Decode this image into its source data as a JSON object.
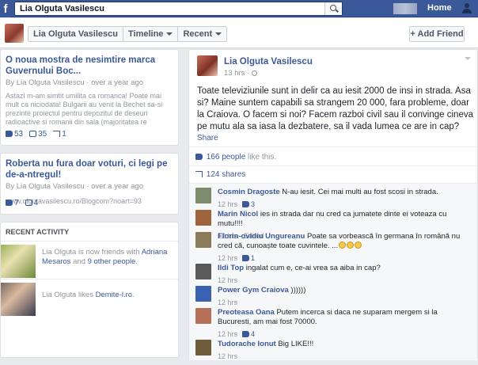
{
  "topbar": {
    "logo": "f",
    "search_value": "Lia Olguta Vasilescu",
    "home": "Home"
  },
  "subbar": {
    "name": "Lia Olguta Vasilescu",
    "timeline": "Timeline",
    "recent": "Recent",
    "add_friend": "Add Friend"
  },
  "left_posts": [
    {
      "title": "O noua mostra de nesimtire marca Guvernului Boc...",
      "meta": "By Lia Olguta Vasilescu · over a year ago",
      "body": "Astazi m-am simtit umilita ca romanca! Poate mai mult ca niciodata! Bulgarii au venit la Bechet sa-si prezinte proiectul pentru depozitul de deseuri radioactive si romanii din sala (majoritatea re",
      "likes": "53",
      "comments": "35",
      "shares": "1"
    },
    {
      "title": "Roberta nu fura doar voturi, ci legi pe de-a-ntregul!",
      "meta": "By Lia Olguta Vasilescu · over a year ago",
      "link": "www.olgutavasilescu.ro/Blogcom?noart=93",
      "likes": "7",
      "comments": "4"
    }
  ],
  "recent_activity": {
    "heading": "RECENT ACTIVITY",
    "items": [
      {
        "pre": "Lia Olguta is now friends with ",
        "link1": "Adriana Mesaros",
        "mid": " and ",
        "link2": "9 other people",
        "post": "."
      },
      {
        "pre": "Lia Olguta likes ",
        "link1": "Demite-l.ro",
        "post": "."
      }
    ]
  },
  "main_post": {
    "author": "Lia Olguta Vasilescu",
    "time": "13 hrs ·",
    "text": "Toate televiziunile sunt in delir ca au iesit 2000 de insi in strada. Asa si? Maine suntem capabili sa strangem 20 000, fara probleme, doar la Craiova. O facem si noi? Facem razboi civil sau il convinge cineva pe mutu ala sa iasa la dezbatere, sa il vada lumea ce are in cap?",
    "share": "Share",
    "likes_count": "166 people",
    "likes_rest": " like this.",
    "shares": "124 shares"
  },
  "comments": [
    {
      "name": "Cosmin Dragoste",
      "text": " N-au iesit. Cei mai multi au fost scosi in strada.",
      "meta": "12 hrs",
      "likes": "3",
      "color": "#7d8c6a"
    },
    {
      "name": "Marin Nicol",
      "text": " ies in strada dar nu cred ca jumatete dinte ei voteaza cu mutu!!!!",
      "meta": "12 hrs · Edited",
      "likes": "",
      "color": "#a0643c"
    },
    {
      "name": "Florin-ovidiu Ungureanu",
      "text": " Poate sa vorbească în germana în română nu cred că, cunoaște toate cuvintele. ...",
      "meta": "12 hrs",
      "likes": "1",
      "color": "#8a7a5a"
    },
    {
      "name": "Ildi Top",
      "text": " ingalat cum e, ce-ai vrea sa aiba in cap?",
      "meta": "12 hrs",
      "likes": "",
      "color": "#5a5a5a"
    },
    {
      "name": "Power Gym Craiova",
      "text": " ))))))",
      "meta": "12 hrs",
      "likes": "",
      "color": "#3a62b0"
    },
    {
      "name": "Preoteasa Oana",
      "text": " Putem incerca si daca ne suparam mergem si la Bucuresti, am mai fost 70000.",
      "meta": "12 hrs",
      "likes": "4",
      "color": "#b5705a"
    },
    {
      "name": "Tudorache Ionut",
      "text": " Big LIKE!!!",
      "meta": "12 hrs",
      "likes": "",
      "color": "#6e5c3a"
    }
  ]
}
